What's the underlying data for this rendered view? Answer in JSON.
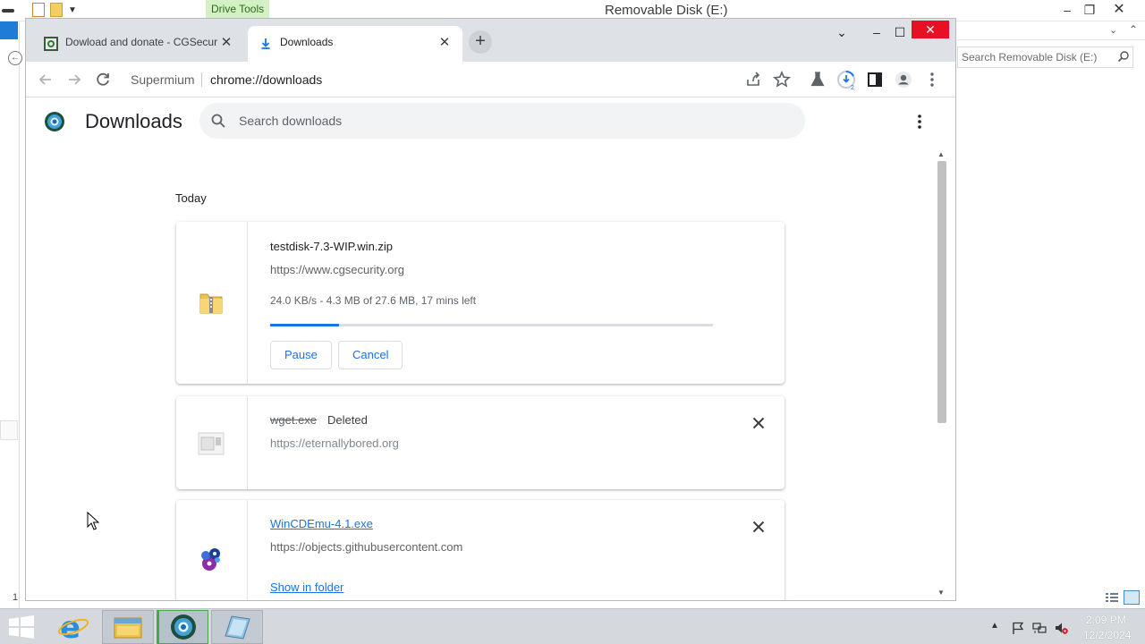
{
  "explorer": {
    "title": "Removable Disk (E:)",
    "ribbon_tab": "Drive Tools",
    "search_placeholder": "Search Removable Disk (E:)",
    "left_number": "1"
  },
  "chrome": {
    "tabs": [
      {
        "title": "Dowload and donate - CGSecurity",
        "active": false
      },
      {
        "title": "Downloads",
        "active": true
      }
    ],
    "omnibox": {
      "site_label": "Supermium",
      "url": "chrome://downloads"
    },
    "downloads_badge": "2"
  },
  "downloads": {
    "title": "Downloads",
    "search_placeholder": "Search downloads",
    "date_group": "Today",
    "items": [
      {
        "file": "testdisk-7.3-WIP.win.zip",
        "url": "https://www.cgsecurity.org",
        "status": "24.0 KB/s - 4.3 MB of 27.6 MB, 17 mins left",
        "progress": 0.155,
        "actions": [
          "Pause",
          "Cancel"
        ],
        "icon": "zip-folder-icon"
      },
      {
        "file": "wget.exe",
        "tag": "Deleted",
        "url": "https://eternallybored.org",
        "icon": "generic-file-icon"
      },
      {
        "file": "WinCDEmu-4.1.exe",
        "url": "https://objects.githubusercontent.com",
        "action": "Show in folder",
        "icon": "wincdemu-icon"
      }
    ]
  },
  "taskbar": {
    "time": "2:09 PM",
    "date": "12/2/2024"
  },
  "colors": {
    "accent": "#1a73e8",
    "close_red": "#e81123",
    "tabstrip": "#dee1e6",
    "drive_tools": "#d3f1c4"
  }
}
